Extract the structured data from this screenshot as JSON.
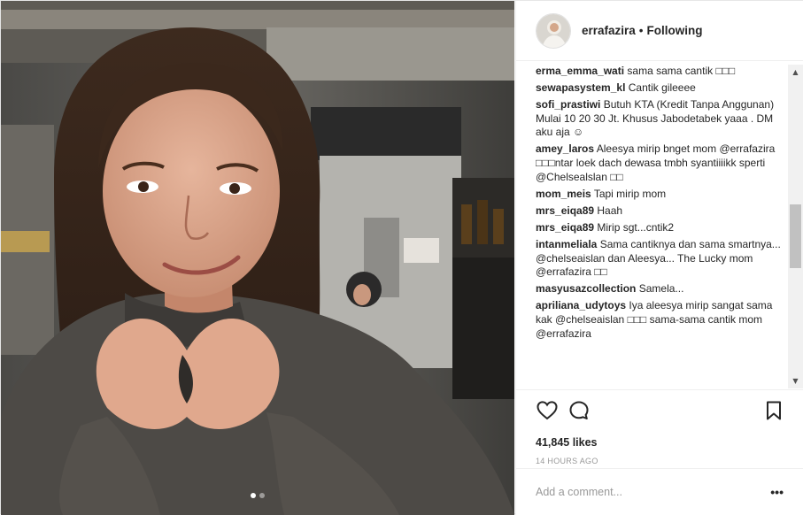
{
  "post": {
    "username": "errafazira",
    "separator": "•",
    "follow_state": "Following",
    "comments": [
      {
        "user": "erma_emma_wati",
        "text": "sama sama cantik □□□"
      },
      {
        "user": "sewapasystem_kl",
        "text": "Cantik gileeee"
      },
      {
        "user": "sofi_prastiwi",
        "text": "Butuh KTA (Kredit Tanpa Anggunan) Mulai 10 20 30 Jt. Khusus Jabodetabek yaaa . DM aku aja ☺"
      },
      {
        "user": "amey_laros",
        "text": "Aleesya mirip bnget mom @errafazira □□□ntar loek dach dewasa tmbh syantiiiikk sperti @Chelsealslan □□"
      },
      {
        "user": "mom_meis",
        "text": "Tapi mirip mom"
      },
      {
        "user": "mrs_eiqa89",
        "text": "Haah"
      },
      {
        "user": "mrs_eiqa89",
        "text": "Mirip sgt...cntik2"
      },
      {
        "user": "intanmeliala",
        "text": "Sama cantiknya dan sama smartnya... @chelseaislan dan Aleesya... The Lucky mom @errafazira □□"
      },
      {
        "user": "masyusazcollection",
        "text": "Samela..."
      },
      {
        "user": "apriliana_udytoys",
        "text": "Iya aleesya mirip sangat sama kak @chelseaislan □□□ sama-sama cantik mom @errafazira"
      }
    ],
    "likes_text": "41,845 likes",
    "time_text": "14 HOURS AGO",
    "comment_placeholder": "Add a comment...",
    "more_label": "•••",
    "carousel": {
      "count": 2,
      "active": 0
    }
  },
  "icons": {
    "like": "heart-icon",
    "comment": "comment-bubble-icon",
    "save": "bookmark-icon",
    "scroll_up": "▲",
    "scroll_down": "▼"
  },
  "colors": {
    "text": "#262626",
    "muted": "#999999",
    "border": "#efefef",
    "scroll_track": "#f1f1f1",
    "scroll_thumb": "#c1c1c1"
  }
}
